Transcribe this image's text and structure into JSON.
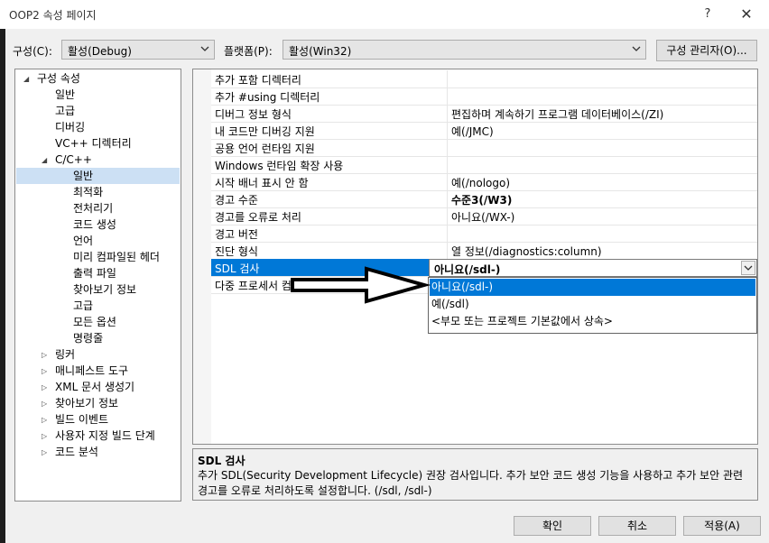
{
  "window": {
    "title": "OOP2 속성 페이지",
    "help": "?",
    "close": "✕"
  },
  "toolbar": {
    "config_label": "구성(C):",
    "config_value": "활성(Debug)",
    "platform_label": "플랫폼(P):",
    "platform_value": "활성(Win32)",
    "config_manager": "구성 관리자(O)..."
  },
  "tree": {
    "root": "구성 속성",
    "general": "일반",
    "advanced": "고급",
    "debugging": "디버깅",
    "vc_dirs": "VC++ 디렉터리",
    "cpp": "C/C++",
    "cpp_items": [
      "일반",
      "최적화",
      "전처리기",
      "코드 생성",
      "언어",
      "미리 컴파일된 헤더",
      "출력 파일",
      "찾아보기 정보",
      "고급",
      "모든 옵션",
      "명령줄"
    ],
    "collapsed": [
      "링커",
      "매니페스트 도구",
      "XML 문서 생성기",
      "찾아보기 정보",
      "빌드 이벤트",
      "사용자 지정 빌드 단계",
      "코드 분석"
    ]
  },
  "grid": {
    "rows": [
      {
        "name": "추가 포함 디렉터리",
        "value": ""
      },
      {
        "name": "추가 #using 디렉터리",
        "value": ""
      },
      {
        "name": "디버그 정보 형식",
        "value": "편집하며 계속하기 프로그램 데이터베이스(/ZI)"
      },
      {
        "name": "내 코드만 디버깅 지원",
        "value": "예(/JMC)"
      },
      {
        "name": "공용 언어 런타임 지원",
        "value": ""
      },
      {
        "name": "Windows 런타임 확장 사용",
        "value": ""
      },
      {
        "name": "시작 배너 표시 안 함",
        "value": "예(/nologo)"
      },
      {
        "name": "경고 수준",
        "value": "수준3(/W3)"
      },
      {
        "name": "경고를 오류로 처리",
        "value": "아니요(/WX-)"
      },
      {
        "name": "경고 버전",
        "value": ""
      },
      {
        "name": "진단 형식",
        "value": "열 정보(/diagnostics:column)"
      },
      {
        "name": "SDL 검사",
        "value": "아니요(/sdl-)"
      },
      {
        "name": "다중 프로세서 컴파일",
        "value": ""
      }
    ],
    "dropdown_options": [
      "아니요(/sdl-)",
      "예(/sdl)",
      "<부모 또는 프로젝트 기본값에서 상속>"
    ]
  },
  "description": {
    "title": "SDL 검사",
    "text": "추가 SDL(Security Development Lifecycle) 권장 검사입니다. 추가 보안 코드 생성 기능을 사용하고 추가 보안 관련 경고를 오류로 처리하도록 설정합니다. (/sdl, /sdl-)"
  },
  "buttons": {
    "ok": "확인",
    "cancel": "취소",
    "apply": "적용(A)"
  },
  "colors": {
    "selection": "#0078d7",
    "background": "#f0f0f0"
  }
}
